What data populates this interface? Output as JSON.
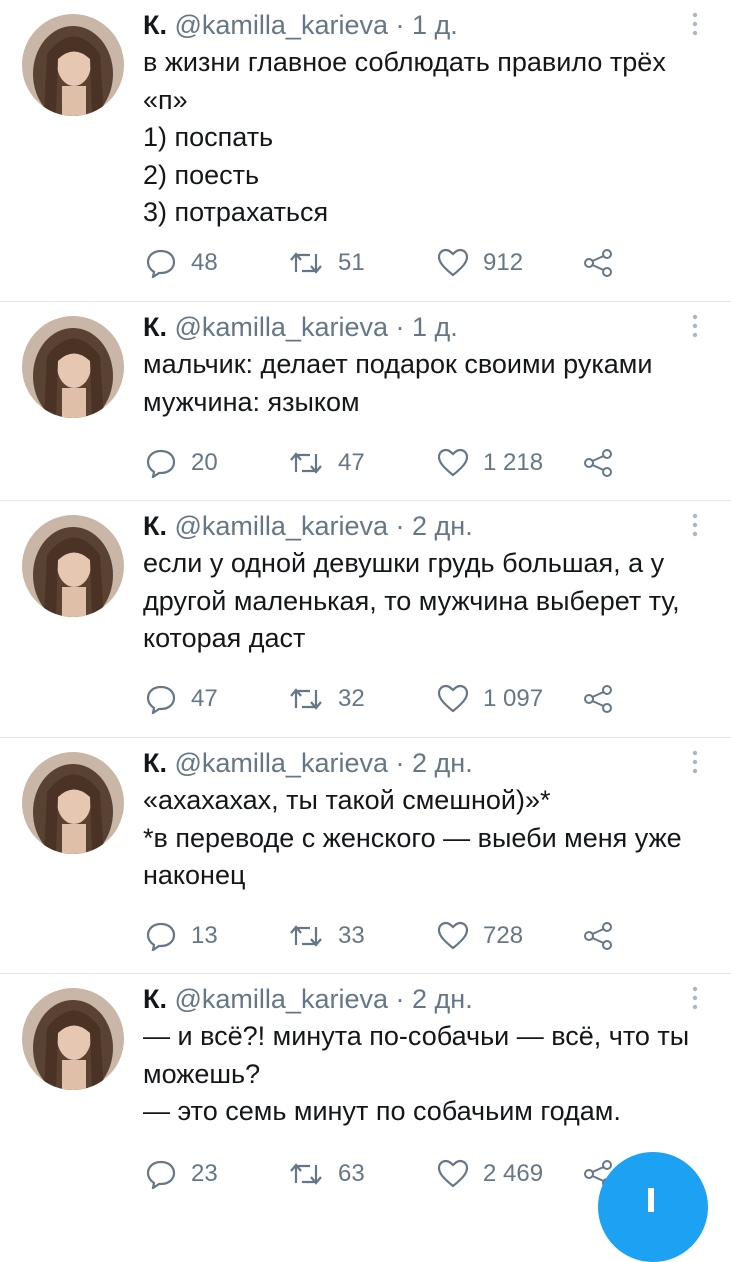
{
  "tweets": [
    {
      "name": "К.",
      "handle": "@kamilla_karieva",
      "separator": "·",
      "time": "1 д.",
      "lines": [
        "в жизни главное соблюдать правило трёх",
        "«п»",
        "1) поспать",
        "2) поесть",
        "3) потрахаться"
      ],
      "replies": "48",
      "retweets": "51",
      "likes": "912"
    },
    {
      "name": "К.",
      "handle": "@kamilla_karieva",
      "separator": "·",
      "time": "1 д.",
      "lines": [
        "мальчик: делает подарок своими руками",
        "мужчина: языком"
      ],
      "replies": "20",
      "retweets": "47",
      "likes": "1 218"
    },
    {
      "name": "К.",
      "handle": "@kamilla_karieva",
      "separator": "·",
      "time": "2 дн.",
      "lines": [
        "если у одной девушки грудь большая, а у",
        "другой маленькая, то мужчина выберет ту,",
        "которая даст"
      ],
      "replies": "47",
      "retweets": "32",
      "likes": "1 097"
    },
    {
      "name": "К.",
      "handle": "@kamilla_karieva",
      "separator": "·",
      "time": "2 дн.",
      "lines": [
        "«ахахахах, ты такой смешной)»*",
        "*в переводе с женского — выеби меня уже",
        "наконец"
      ],
      "replies": "13",
      "retweets": "33",
      "likes": "728"
    },
    {
      "name": "К.",
      "handle": "@kamilla_karieva",
      "separator": "·",
      "time": "2 дн.",
      "lines": [
        "— и всё?! минута по-собачьи — всё, что ты",
        "можешь?",
        "— это семь минут по собачьим годам."
      ],
      "replies": "23",
      "retweets": "63",
      "likes": "2 469"
    }
  ],
  "colors": {
    "accent": "#1da1f2",
    "muted": "#657786",
    "divider": "#e1e8ed",
    "text": "#14171a"
  },
  "icons": [
    "reply-icon",
    "retweet-icon",
    "like-icon",
    "share-icon",
    "more-icon",
    "compose-icon"
  ]
}
